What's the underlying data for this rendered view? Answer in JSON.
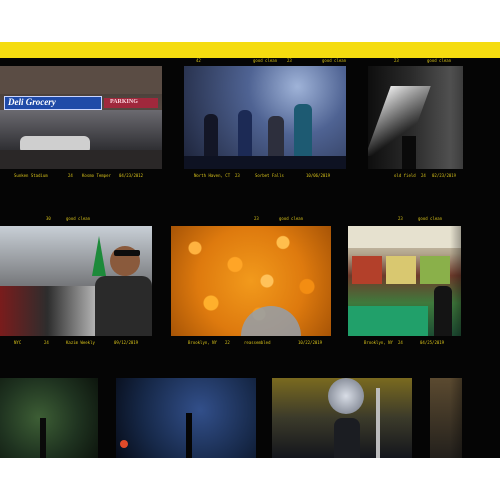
{
  "page": {
    "band_color": "#f5dc10",
    "sheet_color": "#050505",
    "edge_text_color": "#d9c31a"
  },
  "rows": [
    {
      "edge_marks": [
        "42",
        "good clean",
        "23",
        "good clean",
        "23",
        "good clean"
      ],
      "captions": [
        [
          "Sunken Stadium",
          "24",
          "Kosmo Temper",
          "04/23/2012"
        ],
        [
          "North Haven, CT",
          "23",
          "Sorbet Falls",
          "10/06/2019"
        ],
        [
          "old field",
          "24",
          "02/23/2019"
        ]
      ]
    },
    {
      "edge_marks": [
        "30",
        "good clean",
        "23",
        "good clean",
        "23",
        "good clean"
      ],
      "captions": [
        [
          "NYC",
          "24",
          "Kazim Weekly",
          "09/12/2019"
        ],
        [
          "Brooklyn, NY",
          "22",
          "reassembled",
          "10/22/2019"
        ],
        [
          "Brooklyn, NY",
          "24",
          "04/25/2019"
        ]
      ]
    }
  ],
  "frames": [
    {
      "sign_text": "Deli Grocery",
      "sign_alt": "PARKING"
    },
    {
      "subject": "stage-dancers"
    },
    {
      "subject": "spotlight"
    },
    {
      "subject": "parade-rider"
    },
    {
      "subject": "marigolds"
    },
    {
      "subject": "fruit-stand"
    },
    {
      "subject": "tree-canopy"
    },
    {
      "subject": "night-tree"
    },
    {
      "subject": "sousaphone-player"
    },
    {
      "subject": "bridge-structure"
    }
  ]
}
